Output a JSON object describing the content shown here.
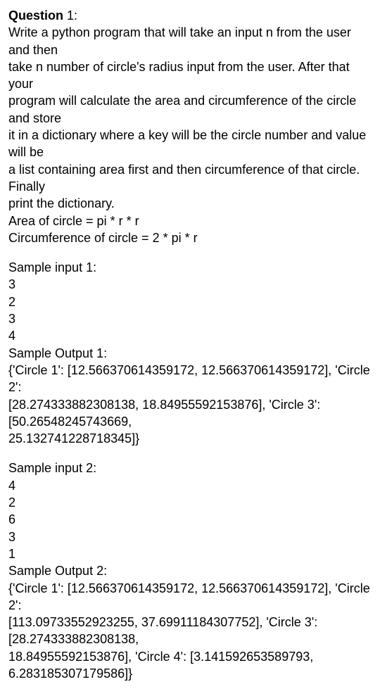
{
  "question": {
    "label_bold": "Question",
    "label_num": " 1:",
    "lines": [
      "Write a python program that will take an input n from the user and then",
      "take n number of circle's radius input from the user. After that your",
      "program will calculate the area and circumference of the circle and store",
      "it in a dictionary where a key will be the circle number and value will be",
      "a list containing area first and then circumference of that circle. Finally",
      "print the dictionary.",
      "Area of circle = pi * r * r",
      "Circumference of circle = 2 * pi * r"
    ]
  },
  "sample1": {
    "input_label": "Sample input 1:",
    "input_lines": [
      "3",
      "2",
      "3",
      "4"
    ],
    "output_label": "Sample Output 1:",
    "output_lines": [
      "{'Circle 1': [12.566370614359172, 12.566370614359172], 'Circle 2':",
      "[28.274333882308138, 18.84955592153876], 'Circle 3': [50.26548245743669,",
      "25.132741228718345]}"
    ]
  },
  "sample2": {
    "input_label": "Sample input 2:",
    "input_lines": [
      "4",
      "2",
      "6",
      "3",
      "1"
    ],
    "output_label": "Sample Output 2:",
    "output_lines": [
      "{'Circle 1': [12.566370614359172, 12.566370614359172], 'Circle 2':",
      "[113.09733552923255, 37.69911184307752], 'Circle 3': [28.274333882308138,",
      "18.84955592153876], 'Circle 4': [3.141592653589793, 6.283185307179586]}"
    ]
  }
}
